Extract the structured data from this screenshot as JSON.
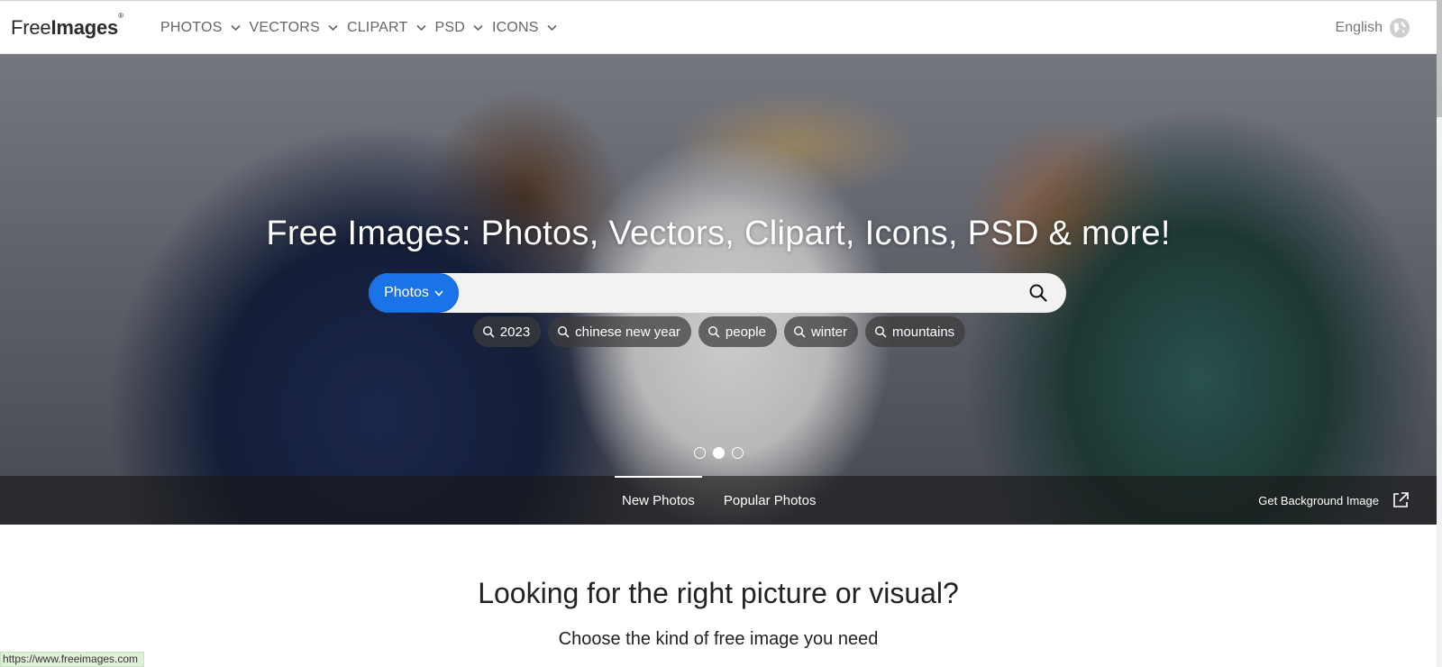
{
  "logo": {
    "part1": "Free",
    "part2": "Images",
    "mark": "®"
  },
  "nav": {
    "items": [
      {
        "label": "PHOTOS"
      },
      {
        "label": "VECTORS"
      },
      {
        "label": "CLIPART"
      },
      {
        "label": "PSD"
      },
      {
        "label": "ICONS"
      }
    ],
    "language": "English",
    "icons": {
      "dropdown": "chevron-down-icon",
      "language": "globe-icon"
    }
  },
  "hero": {
    "title": "Free Images: Photos, Vectors, Clipart, Icons, PSD & more!",
    "search": {
      "type_label": "Photos",
      "value": "",
      "placeholder": ""
    },
    "chips": [
      {
        "label": "2023"
      },
      {
        "label": "chinese new year"
      },
      {
        "label": "people"
      },
      {
        "label": "winter"
      },
      {
        "label": "mountains"
      }
    ],
    "carousel": {
      "count": 3,
      "active_index": 1
    },
    "tabs": [
      {
        "label": "New Photos",
        "active": true
      },
      {
        "label": "Popular Photos",
        "active": false
      }
    ],
    "background_link": "Get Background Image"
  },
  "main": {
    "title": "Looking for the right picture or visual?",
    "subtitle": "Choose the kind of free image you need"
  },
  "status_bar": {
    "url": "https://www.freeimages.com"
  },
  "colors": {
    "accent": "#1a73e8",
    "nav_text": "#666666",
    "status_bg": "#dff0d8"
  }
}
